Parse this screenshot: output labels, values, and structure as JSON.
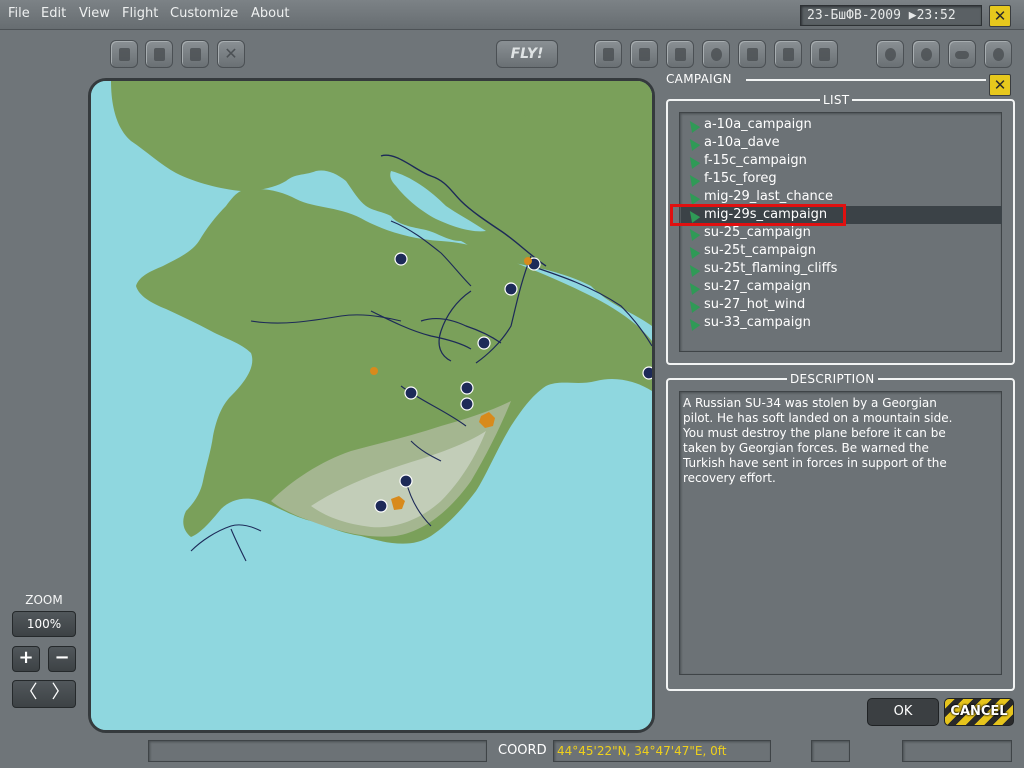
{
  "menu": {
    "items": [
      "File",
      "Edit",
      "View",
      "Flight",
      "Customize",
      "About"
    ]
  },
  "clock": "23-БшФВ-2009 ▶23:52",
  "toolbar": {
    "fly_label": "FLY!",
    "left_icons": [
      "new-mission-icon",
      "open-icon",
      "save-icon",
      "close-icon"
    ],
    "mid_icons": [
      "map-options-icon",
      "briefing-icon",
      "notes-icon",
      "weather-icon",
      "encyclopedia-icon",
      "logbook-icon",
      "sound-icon"
    ],
    "right_icons": [
      "options-icon",
      "filter-icon",
      "cloud-icon",
      "clock-icon"
    ]
  },
  "campaign": {
    "title": "CAMPAIGN",
    "list_title": "LIST",
    "items": [
      "a-10a_campaign",
      "a-10a_dave",
      "f-15c_campaign",
      "f-15c_foreg",
      "mig-29_last_chance",
      "mig-29s_campaign",
      "su-25_campaign",
      "su-25t_campaign",
      "su-25t_flaming_cliffs",
      "su-27_campaign",
      "su-27_hot_wind",
      "su-33_campaign"
    ],
    "selected_index": 5,
    "description_title": "DESCRIPTION",
    "description_lines": [
      "A Russian SU-34 was stolen by  a Georgian",
      "pilot. He has soft landed on a mountain side.",
      "You must destroy the plane before it can be",
      "taken by Georgian forces. Be warned the",
      "Turkish have sent in forces in support of the",
      "recovery effort."
    ],
    "ok_label": "OK",
    "cancel_label": "CANCEL"
  },
  "zoom": {
    "label": "ZOOM",
    "value": "100%",
    "plus": "+",
    "minus": "−",
    "left": "〈",
    "right": "〉"
  },
  "status": {
    "coord_label": "COORD",
    "coord_value": "44°45'22\"N, 34°47'47\"E, 0ft"
  },
  "colors": {
    "sea": "#8fd7df",
    "land": "#7aa05a",
    "highlight": "#e01010",
    "accent_yellow": "#e7c81d",
    "coord_text": "#efd01b"
  }
}
